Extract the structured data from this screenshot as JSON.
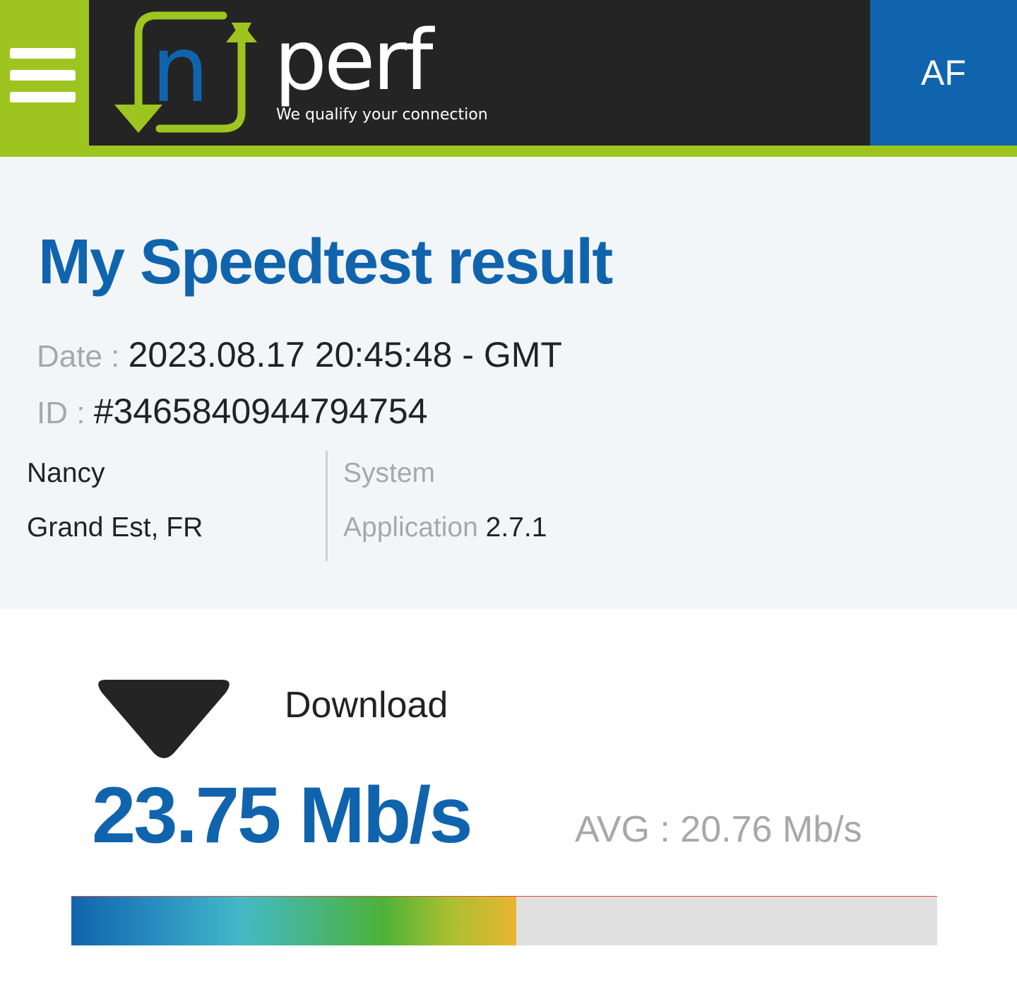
{
  "header": {
    "menu_icon": "hamburger-menu-icon",
    "logo_text": "perf",
    "logo_letter": "n",
    "tagline": "We qualify your connection",
    "lang": "AF",
    "colors": {
      "green": "#9ec51f",
      "dark": "#242424",
      "blue": "#1064ad"
    }
  },
  "result": {
    "title": "My Speedtest result",
    "date_label": "Date : ",
    "date_value": "2023.08.17 20:45:48 - GMT",
    "id_label": "ID : ",
    "id_value": "#3465840944794754",
    "city": "Nancy",
    "region": "Grand Est, FR",
    "system_label": "System",
    "application_label": "Application",
    "application_version": "2.7.1"
  },
  "download": {
    "icon": "download-arrow-icon",
    "label": "Download",
    "value": "23.75 Mb/s",
    "avg": "AVG : 20.76 Mb/s",
    "progress_fraction": 0.514
  }
}
